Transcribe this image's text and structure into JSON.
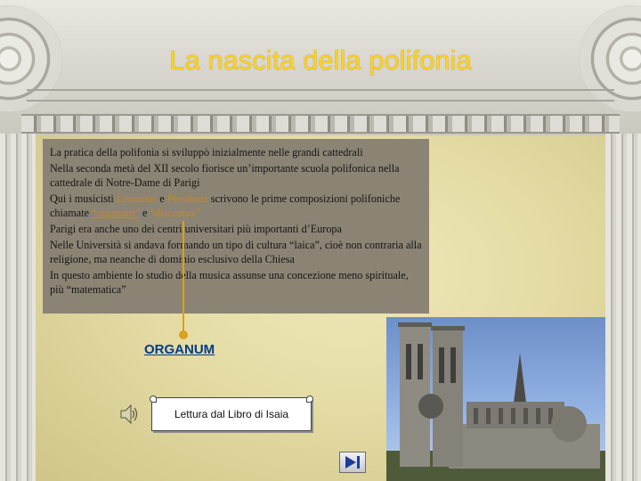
{
  "slide": {
    "title": "La nascita della polifonia"
  },
  "textbox": {
    "p1": "La pratica della polifonia si sviluppò inizialmente nelle grandi cattedrali",
    "p2": "Nella seconda metà del XII secolo fiorisce un’importante scuola polifonica nella cattedrale di Notre-Dame di Parigi",
    "p3_pre": "Qui i musicisti ",
    "p3_name1": "Leoninus",
    "p3_and": " e ",
    "p3_name2": "Perotinus",
    "p3_mid": " scrivono le prime composizioni polifoniche chiamate ",
    "p3_term1": "“organum”",
    "p3_and2": " e ",
    "p3_term2": "“discantus”",
    "p4": "Parigi era anche uno dei centri universitari più importanti d’Europa",
    "p5": "Nelle Università si andava formando un tipo di cultura “laica”, cioè non contraria alla religione, ma neanche di dominio esclusivo della Chiesa",
    "p6": "In questo ambiente lo studio della musica assunse una concezione meno spirituale, più “matematica”"
  },
  "links": {
    "organum": "ORGANUM"
  },
  "audio": {
    "reading_label": "Lettura dal Libro di Isaia"
  },
  "colors": {
    "title": "#ffd21a",
    "highlight": "#c58a1c",
    "link": "#003b8a",
    "textbox_bg": "#8b8475"
  },
  "icons": {
    "speaker": "speaker-icon",
    "nav": "end-show-icon"
  }
}
